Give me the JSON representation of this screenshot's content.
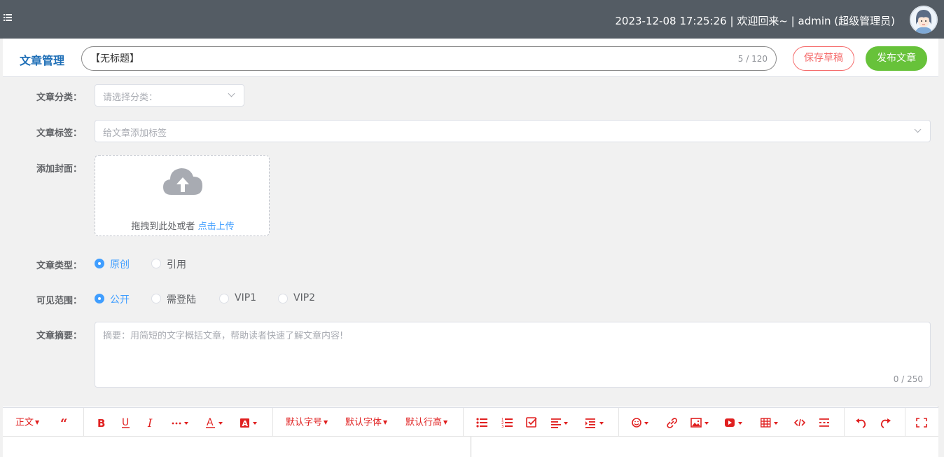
{
  "topbar": {
    "datetime": "2023-12-08 17:25:26",
    "welcome": "欢迎回来~",
    "user": "admin (超级管理员)",
    "separator": "|"
  },
  "header": {
    "title": "文章管理",
    "title_input_value": "【无标题】",
    "title_count": "5 / 120",
    "save_draft_label": "保存草稿",
    "publish_label": "发布文章"
  },
  "form": {
    "category_label": "文章分类：",
    "category_placeholder": "请选择分类：",
    "tag_label": "文章标签：",
    "tag_placeholder": "给文章添加标签",
    "cover_label": "添加封面：",
    "cover_text": "拖拽到此处或者",
    "cover_link": "点击上传",
    "type_label": "文章类型：",
    "type_options": [
      "原创",
      "引用"
    ],
    "type_selected": "原创",
    "visibility_label": "可见范围：",
    "visibility_options": [
      "公开",
      "需登陆",
      "VIP1",
      "VIP2"
    ],
    "visibility_selected": "公开",
    "summary_label": "文章摘要：",
    "summary_placeholder": "摘要：用简短的文字概括文章，帮助读者快速了解文章内容!",
    "summary_count": "0 / 250"
  },
  "editor_toolbar": {
    "heading": "正文",
    "font_size": "默认字号",
    "font_family": "默认字体",
    "line_height": "默认行高",
    "icons": [
      "quote-icon",
      "bold-icon",
      "underline-icon",
      "italic-icon",
      "more-icon",
      "font-color-icon",
      "bg-color-icon",
      "bullet-list-icon",
      "numbered-list-icon",
      "todo-icon",
      "align-icon",
      "indent-icon",
      "emoji-icon",
      "link-icon",
      "image-icon",
      "video-icon",
      "table-icon",
      "code-icon",
      "divider-icon",
      "undo-icon",
      "redo-icon",
      "fullscreen-icon"
    ]
  },
  "colors": {
    "topbar_bg": "#545c64",
    "accent_blue": "#409eff",
    "danger": "#f56c6c",
    "success": "#67c23a",
    "toolbar_red": "#e02020"
  }
}
